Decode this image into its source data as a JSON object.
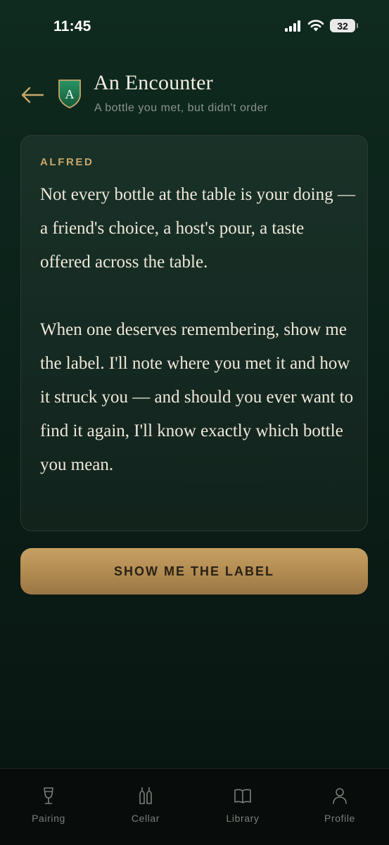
{
  "status_bar": {
    "time": "11:45",
    "battery": "32"
  },
  "header": {
    "title": "An Encounter",
    "subtitle": "A bottle you met, but didn't order",
    "badge_letter": "A"
  },
  "card": {
    "label": "ALFRED",
    "paragraphs": [
      "Not every bottle at the table is your doing — a friend's choice, a host's pour, a taste offered across the table.",
      "When one deserves remembering, show me the label. I'll note where you met it and how it struck you — and should you ever want to find it again, I'll know exactly which bottle you mean."
    ]
  },
  "cta": {
    "label": "SHOW ME THE LABEL"
  },
  "tabs": [
    {
      "label": "Pairing",
      "icon": "wine-glass-icon"
    },
    {
      "label": "Cellar",
      "icon": "bottles-icon"
    },
    {
      "label": "Library",
      "icon": "book-icon"
    },
    {
      "label": "Profile",
      "icon": "person-icon"
    }
  ],
  "colors": {
    "accent_gold": "#c6a063",
    "badge_green": "#1d7a4f",
    "background": "#0b2119",
    "label_gold": "#c9a76a"
  }
}
